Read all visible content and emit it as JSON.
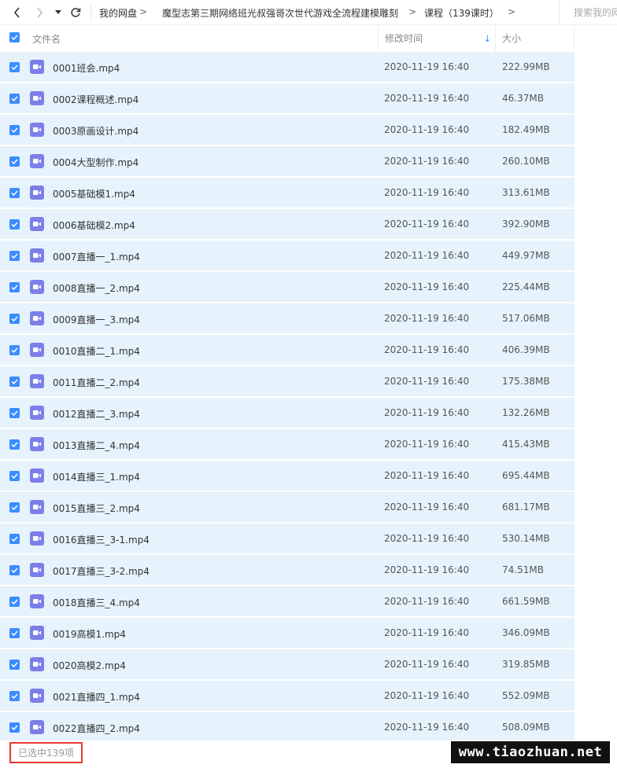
{
  "toolbar": {
    "breadcrumbs": [
      "我的网盘",
      "魔型志第三期网络班光叔强哥次世代游戏全流程建模雕刻",
      "课程（139课时）"
    ],
    "separator": ">",
    "search_placeholder": "搜索我的网盘"
  },
  "table": {
    "header": {
      "name": "文件名",
      "date": "修改时间",
      "size": "大小",
      "sort_indicator": "↓"
    },
    "rows": [
      {
        "name": "0001班会.mp4",
        "date": "2020-11-19 16:40",
        "size": "222.99MB"
      },
      {
        "name": "0002课程概述.mp4",
        "date": "2020-11-19 16:40",
        "size": "46.37MB"
      },
      {
        "name": "0003原画设计.mp4",
        "date": "2020-11-19 16:40",
        "size": "182.49MB"
      },
      {
        "name": "0004大型制作.mp4",
        "date": "2020-11-19 16:40",
        "size": "260.10MB"
      },
      {
        "name": "0005基础模1.mp4",
        "date": "2020-11-19 16:40",
        "size": "313.61MB"
      },
      {
        "name": "0006基础模2.mp4",
        "date": "2020-11-19 16:40",
        "size": "392.90MB"
      },
      {
        "name": "0007直播一_1.mp4",
        "date": "2020-11-19 16:40",
        "size": "449.97MB"
      },
      {
        "name": "0008直播一_2.mp4",
        "date": "2020-11-19 16:40",
        "size": "225.44MB"
      },
      {
        "name": "0009直播一_3.mp4",
        "date": "2020-11-19 16:40",
        "size": "517.06MB"
      },
      {
        "name": "0010直播二_1.mp4",
        "date": "2020-11-19 16:40",
        "size": "406.39MB"
      },
      {
        "name": "0011直播二_2.mp4",
        "date": "2020-11-19 16:40",
        "size": "175.38MB"
      },
      {
        "name": "0012直播二_3.mp4",
        "date": "2020-11-19 16:40",
        "size": "132.26MB"
      },
      {
        "name": "0013直播二_4.mp4",
        "date": "2020-11-19 16:40",
        "size": "415.43MB"
      },
      {
        "name": "0014直播三_1.mp4",
        "date": "2020-11-19 16:40",
        "size": "695.44MB"
      },
      {
        "name": "0015直播三_2.mp4",
        "date": "2020-11-19 16:40",
        "size": "681.17MB"
      },
      {
        "name": "0016直播三_3-1.mp4",
        "date": "2020-11-19 16:40",
        "size": "530.14MB"
      },
      {
        "name": "0017直播三_3-2.mp4",
        "date": "2020-11-19 16:40",
        "size": "74.51MB"
      },
      {
        "name": "0018直播三_4.mp4",
        "date": "2020-11-19 16:40",
        "size": "661.59MB"
      },
      {
        "name": "0019高模1.mp4",
        "date": "2020-11-19 16:40",
        "size": "346.09MB"
      },
      {
        "name": "0020高模2.mp4",
        "date": "2020-11-19 16:40",
        "size": "319.85MB"
      },
      {
        "name": "0021直播四_1.mp4",
        "date": "2020-11-19 16:40",
        "size": "552.09MB"
      },
      {
        "name": "0022直播四_2.mp4",
        "date": "2020-11-19 16:40",
        "size": "508.09MB"
      }
    ]
  },
  "status": {
    "selected_text": "已选中139项"
  },
  "watermark": "www.tiaozhuan.net",
  "colors": {
    "accent": "#3b8cff",
    "row_selected_bg": "#e6f3fc",
    "video_icon": "#7b7fe9",
    "status_border": "#e53935"
  },
  "icons": {
    "file_type": "video-file-icon",
    "checkbox": "checkbox-checked-icon"
  }
}
